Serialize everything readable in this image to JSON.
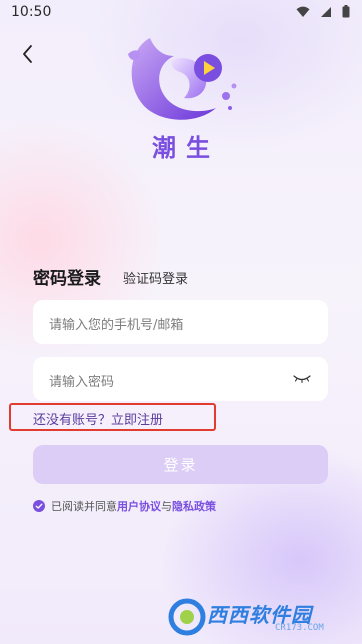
{
  "status_bar": {
    "time": "10:50"
  },
  "brand": {
    "app_name": "潮生",
    "accent_color": "#7a4fe0"
  },
  "login_tabs": {
    "password": "密码登录",
    "sms_code": "验证码登录"
  },
  "form": {
    "phone_placeholder": "请输入您的手机号/邮箱",
    "password_placeholder": "请输入密码"
  },
  "register": {
    "prompt": "还没有账号？",
    "link": "立即注册"
  },
  "login_button": "登录",
  "agreement": {
    "prefix": "已阅读并同意",
    "user_agreement": "用户协议",
    "and": "与",
    "privacy_policy": "隐私政策"
  },
  "watermark": {
    "brand": "西西软件园",
    "url": "CR173.COM"
  },
  "icons": [
    "back-arrow-icon",
    "wifi-icon",
    "signal-icon",
    "battery-icon",
    "eye-closed-icon",
    "check-circle-icon"
  ]
}
